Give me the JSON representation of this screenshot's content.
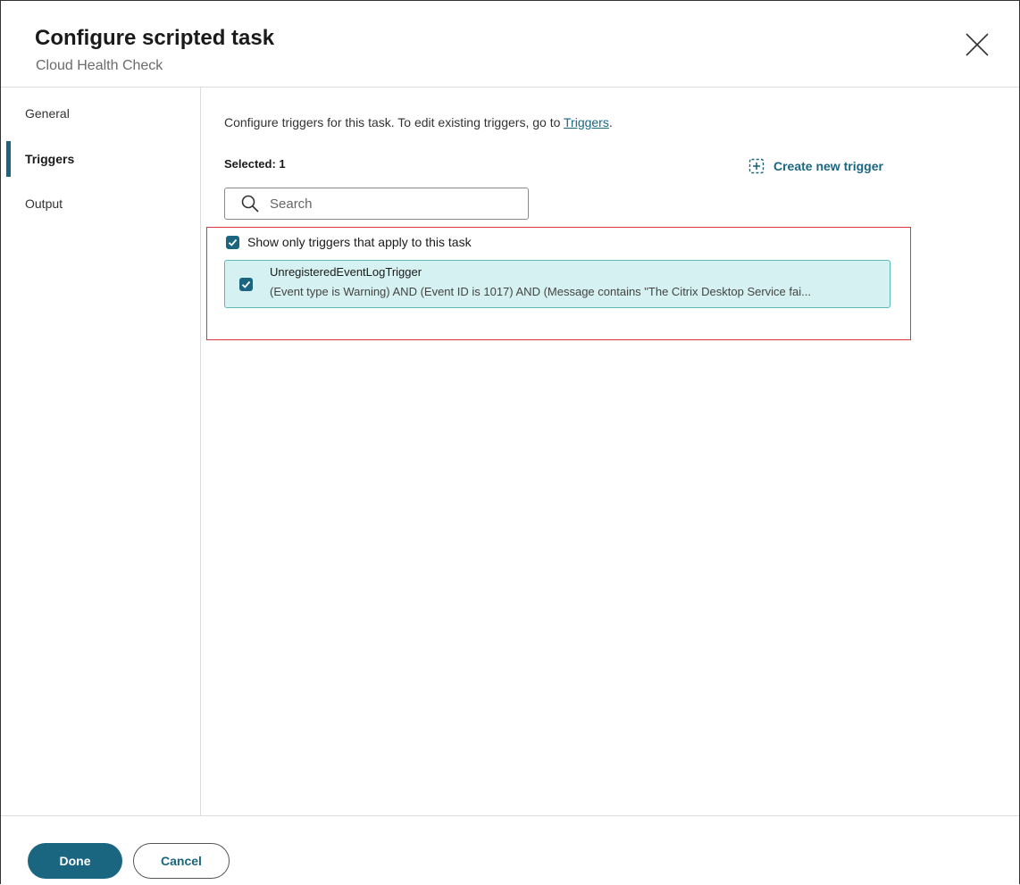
{
  "header": {
    "title": "Configure scripted task",
    "subtitle": "Cloud Health Check"
  },
  "sidebar": {
    "items": [
      {
        "label": "General",
        "active": false
      },
      {
        "label": "Triggers",
        "active": true
      },
      {
        "label": "Output",
        "active": false
      }
    ]
  },
  "main": {
    "intro_text": "Configure triggers for this task. To edit existing triggers, go to ",
    "intro_link": "Triggers",
    "intro_end": ".",
    "selected_label": "Selected: 1",
    "create_trigger_label": "Create new trigger",
    "search_placeholder": "Search",
    "show_only_label": "Show only triggers that apply to this task",
    "show_only_checked": true,
    "triggers": [
      {
        "name": "UnregisteredEventLogTrigger",
        "description": "(Event type is Warning) AND (Event ID is 1017) AND (Message contains \"The Citrix Desktop Service fai...",
        "checked": true
      }
    ]
  },
  "footer": {
    "done_label": "Done",
    "cancel_label": "Cancel"
  },
  "colors": {
    "accent": "#1a6680",
    "selected_card_bg": "#d6f1f1",
    "highlight_border": "#d9363e"
  },
  "icons": {
    "close": "close-icon",
    "search": "search-icon",
    "create": "add-box-icon",
    "check": "check-icon"
  }
}
